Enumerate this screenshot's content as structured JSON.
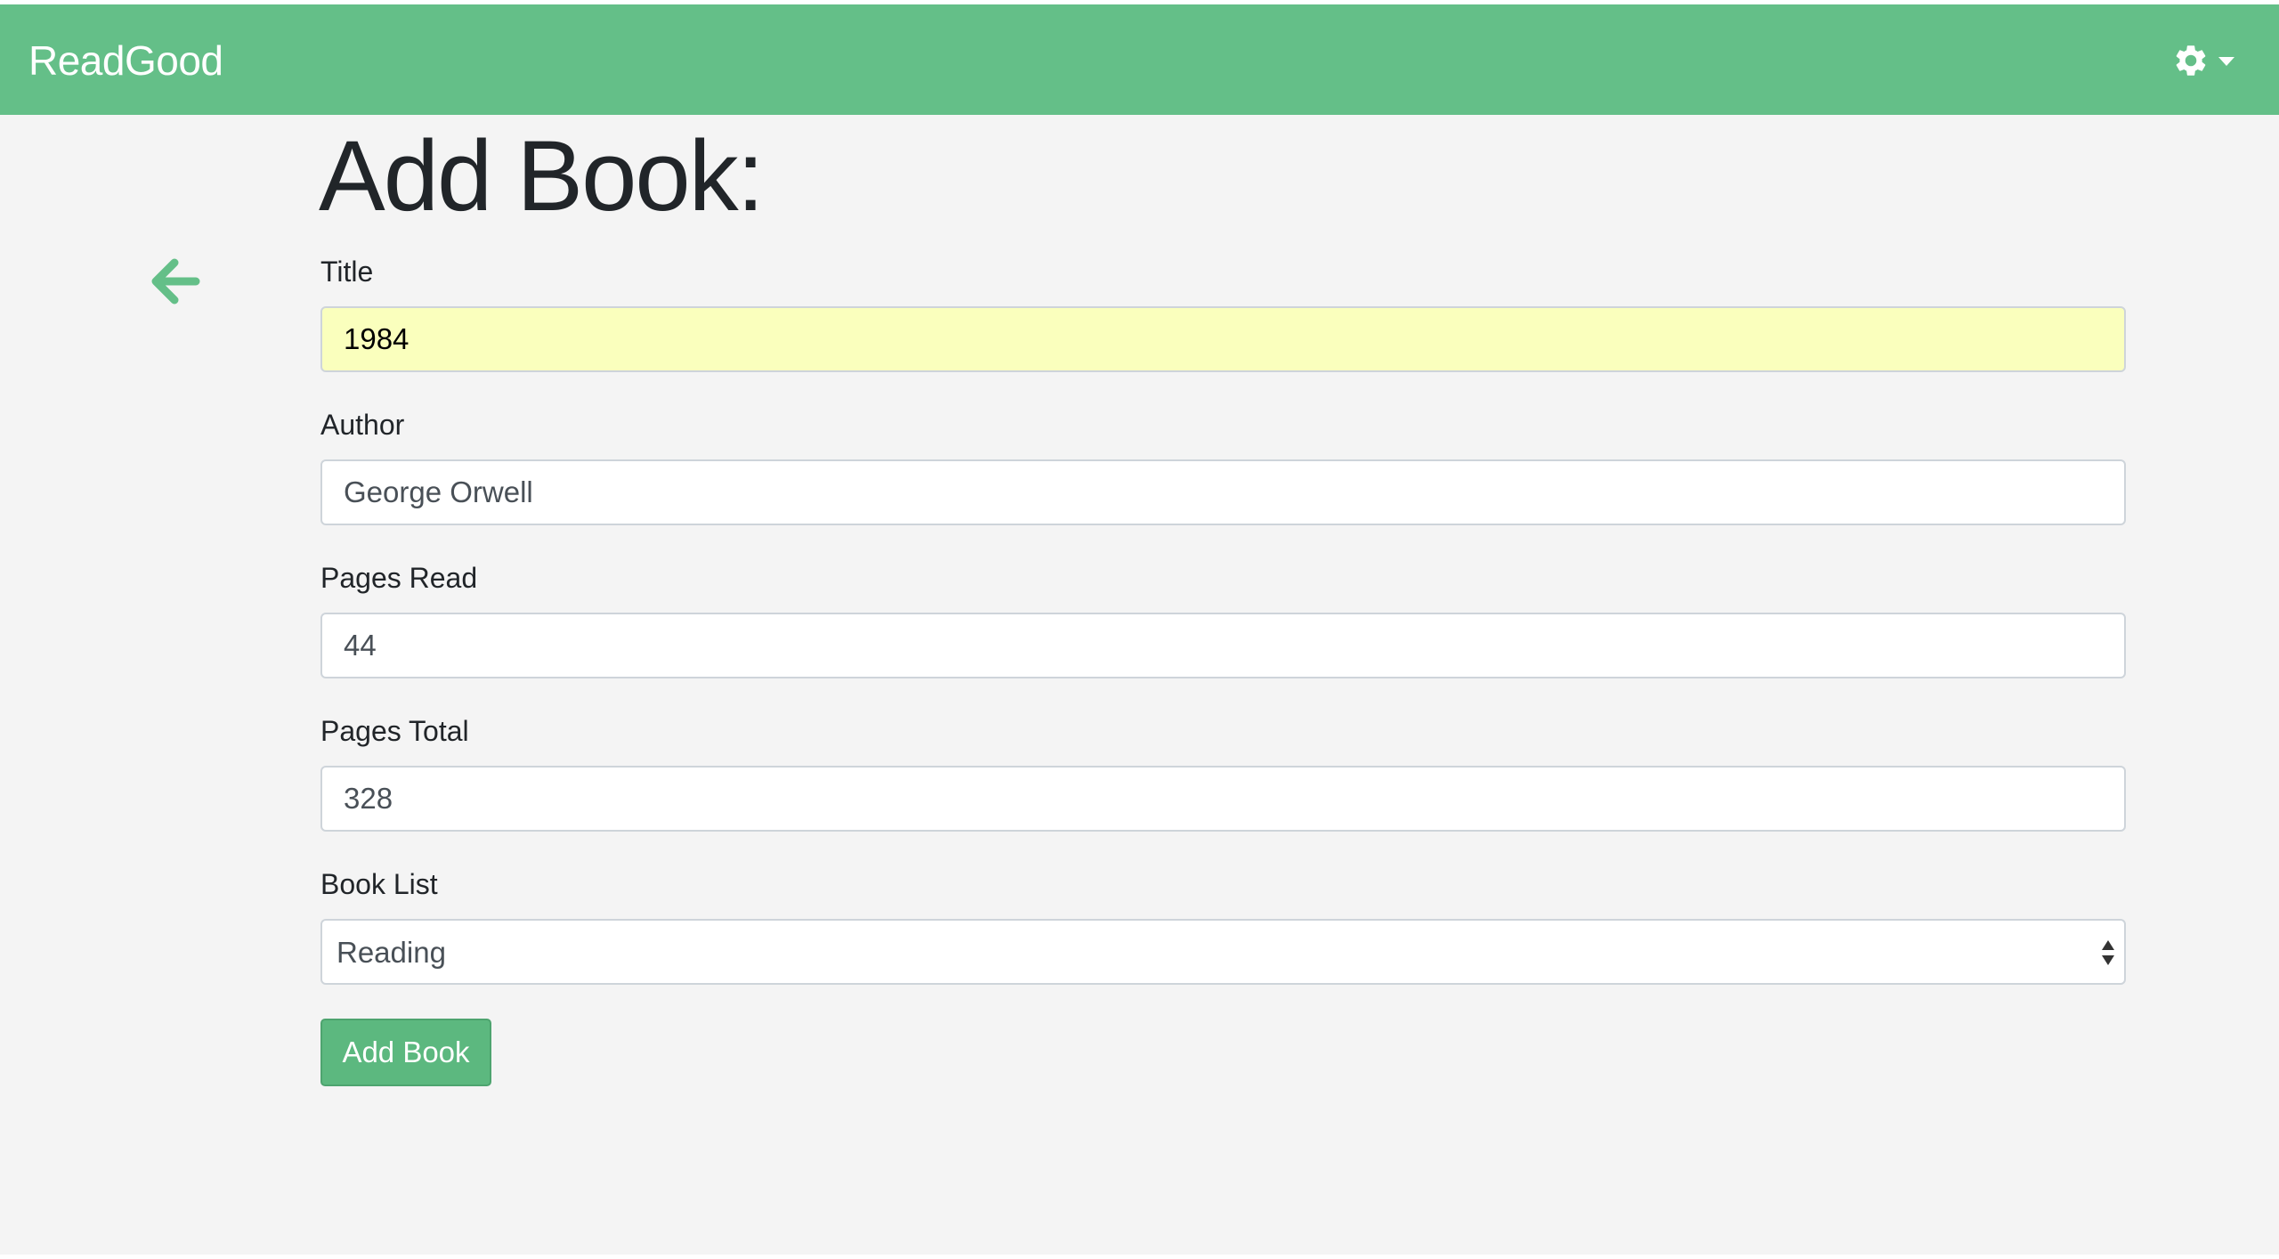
{
  "app": {
    "brand": "ReadGood",
    "accent_color": "#64bf88",
    "settings_icon": "gear-icon",
    "back_icon": "arrow-left-icon"
  },
  "form": {
    "heading": "Add Book:",
    "title": {
      "label": "Title",
      "value": "1984"
    },
    "author": {
      "label": "Author",
      "value": "George Orwell"
    },
    "pages_read": {
      "label": "Pages Read",
      "value": "44"
    },
    "pages_total": {
      "label": "Pages Total",
      "value": "328"
    },
    "book_list": {
      "label": "Book List",
      "selected": "Reading"
    },
    "submit_label": "Add Book"
  }
}
